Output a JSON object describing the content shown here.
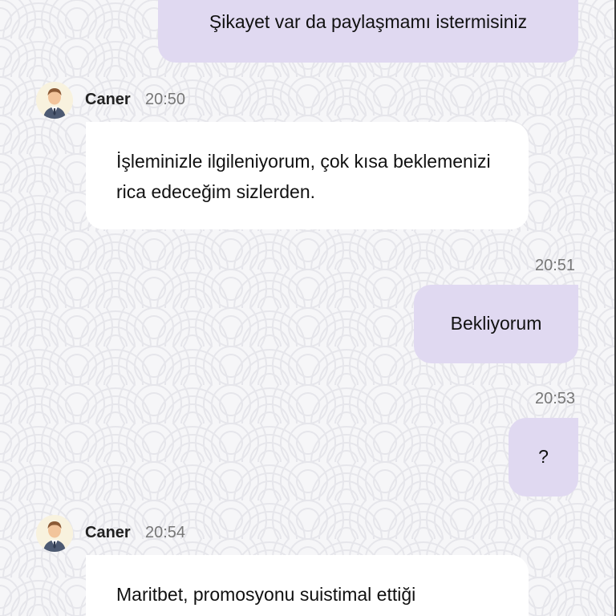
{
  "conversation": {
    "messages": [
      {
        "direction": "outgoing",
        "text": "Şikayet var da paylaşmamı istermisiniz"
      },
      {
        "direction": "incoming",
        "sender": "Caner",
        "time": "20:50",
        "text": "İşleminizle ilgileniyorum, çok kısa beklemenizi rica edeceğim sizlerden."
      },
      {
        "direction": "outgoing",
        "time": "20:51",
        "text": "Bekliyorum"
      },
      {
        "direction": "outgoing",
        "time": "20:53",
        "text": "?"
      },
      {
        "direction": "incoming",
        "sender": "Caner",
        "time": "20:54",
        "text": "Maritbet, promosyonu suistimal ettiği"
      }
    ]
  },
  "theme": {
    "outgoing_bubble": "#e0d9f1",
    "incoming_bubble": "#ffffff",
    "background": "#f6f6f8",
    "pattern": "#e6e6ea"
  },
  "icons": {
    "agent_avatar": "agent-avatar-icon"
  }
}
